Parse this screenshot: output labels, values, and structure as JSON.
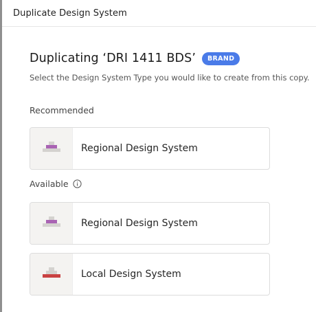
{
  "dialog": {
    "title": "Duplicate Design System"
  },
  "content": {
    "heading": "Duplicating ‘DRI 1411 BDS’",
    "badge": "BRAND",
    "subtitle": "Select the Design System Type you would like to create from this copy."
  },
  "sections": {
    "recommended": {
      "label": "Recommended",
      "options": [
        {
          "label": "Regional Design System",
          "icon": "regional-pyramid-icon",
          "accent": "#a963b3"
        }
      ]
    },
    "available": {
      "label": "Available",
      "info_icon": "info-icon",
      "options": [
        {
          "label": "Regional Design System",
          "icon": "regional-pyramid-icon",
          "accent": "#a963b3"
        },
        {
          "label": "Local Design System",
          "icon": "local-pyramid-icon",
          "accent": "#c94242"
        }
      ]
    }
  },
  "colors": {
    "badge": "#4a7be8",
    "pyramid_gray": "#d4d2cf",
    "regional_accent": "#a963b3",
    "local_accent": "#c94242"
  }
}
